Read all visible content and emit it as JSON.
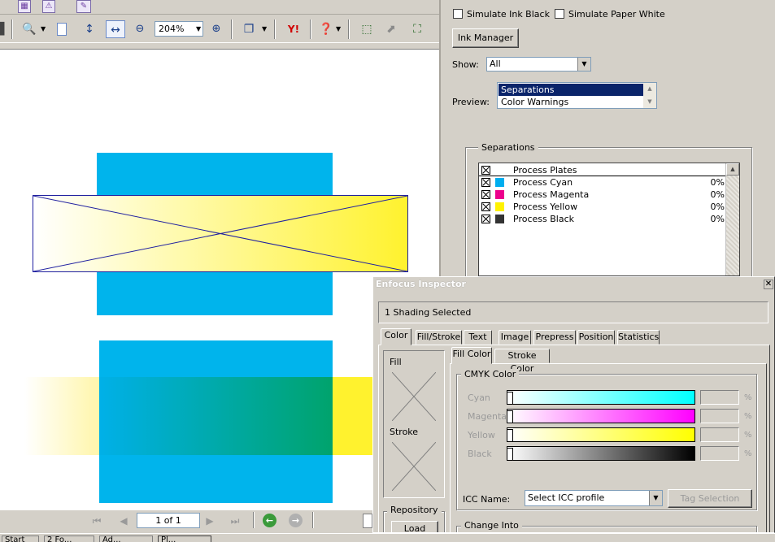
{
  "toolbar": {
    "zoom_value": "204%"
  },
  "navbar": {
    "page_indicator": "1 of 1"
  },
  "output_preview": {
    "simulate_ink_black": "Simulate Ink Black",
    "simulate_paper_white": "Simulate Paper White",
    "ink_manager_button": "Ink Manager",
    "show_label": "Show:",
    "show_value": "All",
    "preview_label": "Preview:",
    "preview_options": [
      "Separations",
      "Color Warnings"
    ],
    "separations_group": "Separations",
    "separations": [
      {
        "name": "Process Plates",
        "percent": "",
        "color": ""
      },
      {
        "name": "Process Cyan",
        "percent": "0%",
        "color": "#00aeef"
      },
      {
        "name": "Process Magenta",
        "percent": "0%",
        "color": "#ec008c"
      },
      {
        "name": "Process Yellow",
        "percent": "0%",
        "color": "#fff200"
      },
      {
        "name": "Process Black",
        "percent": "0%",
        "color": "#333333"
      }
    ]
  },
  "inspector": {
    "title": "Enfocus Inspector",
    "selection_status": "1 Shading Selected",
    "tabs": [
      "Color",
      "Fill/Stroke",
      "Text",
      "Image",
      "Prepress",
      "Position",
      "Statistics"
    ],
    "left_panel": {
      "fill_label": "Fill",
      "stroke_label": "Stroke",
      "repository_label": "Repository",
      "load_button": "Load"
    },
    "sub_tabs": [
      "Fill Color",
      "Stroke Color"
    ],
    "cmyk_group": "CMYK Color",
    "channels": [
      {
        "label": "Cyan",
        "unit": "%",
        "color": "#00ffff"
      },
      {
        "label": "Magenta",
        "unit": "%",
        "color": "#ff00ff"
      },
      {
        "label": "Yellow",
        "unit": "%",
        "color": "#ffff00"
      },
      {
        "label": "Black",
        "unit": "%",
        "color": "#000000"
      }
    ],
    "icc_label": "ICC Name:",
    "icc_value": "Select ICC profile",
    "tag_selection_button": "Tag Selection",
    "change_into_group": "Change Into"
  },
  "taskbar": {
    "items": [
      "Start",
      "2 Fo...",
      "Ad...",
      "Pl..."
    ]
  },
  "colors": {
    "cyan": "#00b4ec",
    "yellow": "#fff22e",
    "green": "#00a36c",
    "selection_blue": "#0a246a"
  }
}
